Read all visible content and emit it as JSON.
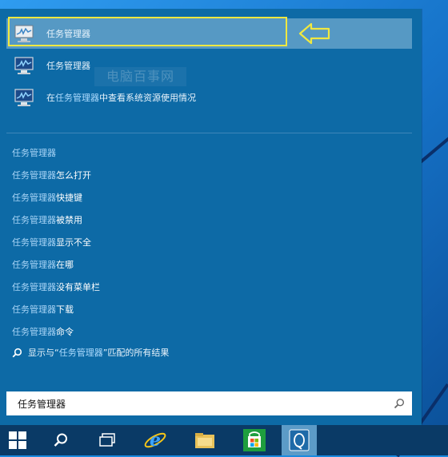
{
  "search_results": [
    {
      "title": "任务管理器"
    },
    {
      "title": "任务管理器"
    },
    {
      "pre": "在",
      "hl": "任务管理器",
      "post": "中查看系统资源使用情况"
    }
  ],
  "watermark": "电脑百事网",
  "suggestions": [
    {
      "hl": "任务管理器",
      "tail": ""
    },
    {
      "hl": "任务管理器",
      "tail": "怎么打开"
    },
    {
      "hl": "任务管理器",
      "tail": "快捷键"
    },
    {
      "hl": "任务管理器",
      "tail": "被禁用"
    },
    {
      "hl": "任务管理器",
      "tail": "显示不全"
    },
    {
      "hl": "任务管理器",
      "tail": "在哪"
    },
    {
      "hl": "任务管理器",
      "tail": "没有菜单栏"
    },
    {
      "hl": "任务管理器",
      "tail": "下载"
    },
    {
      "hl": "任务管理器",
      "tail": "命令"
    }
  ],
  "web_search": {
    "pre": "显示与“",
    "hl": "任务管理器",
    "post": "”匹配的所有结果"
  },
  "search_input": {
    "value": "任务管理器"
  },
  "taskbar": {
    "items": [
      "start-icon",
      "search-icon",
      "task-view-icon",
      "ie-icon",
      "file-explorer-icon",
      "store-icon",
      "qq-icon"
    ]
  },
  "colors": {
    "highlight_box": "#f0e840",
    "panel": "#0d6aa6"
  }
}
